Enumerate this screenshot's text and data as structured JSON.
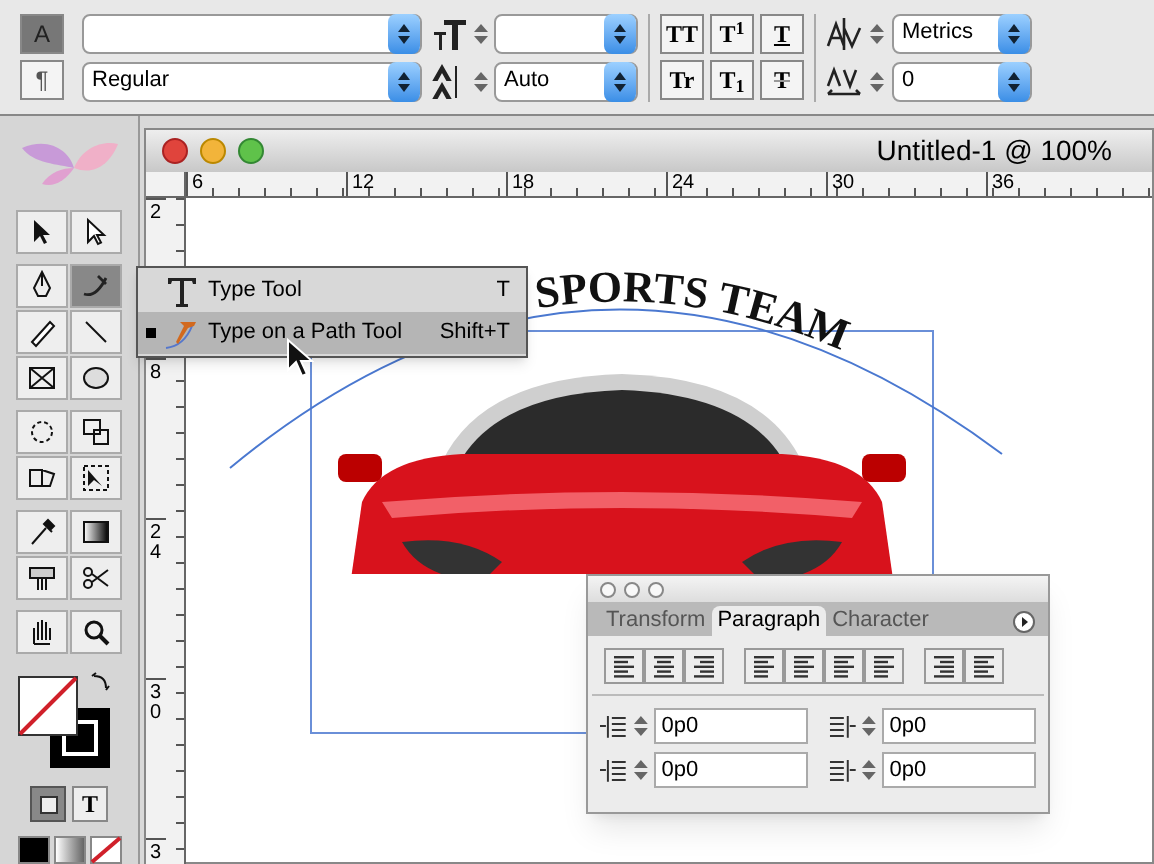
{
  "control_bar": {
    "modes": [
      {
        "label": "A",
        "selected": true
      },
      {
        "label": "¶",
        "selected": false
      }
    ],
    "font_style": "Regular",
    "leading": "Auto",
    "case_buttons": [
      "TT",
      "T$^{1}$",
      "T",
      "Tr",
      "T$_{1}$",
      "T"
    ],
    "kerning": "Metrics",
    "tracking": "0"
  },
  "toolbox": {
    "text_mode": "T"
  },
  "document": {
    "title": "Untitled-1 @ 100%",
    "ruler_h": [
      "6",
      "12",
      "18",
      "24",
      "30",
      "36"
    ],
    "ruler_v": [
      "2",
      "8",
      "24",
      "30",
      "3"
    ],
    "path_text": "SPORTS TEAM"
  },
  "flyout": [
    {
      "label": "Type Tool",
      "shortcut": "T",
      "selected": false
    },
    {
      "label": "Type on a Path Tool",
      "shortcut": "Shift+T",
      "selected": true
    }
  ],
  "paragraph_panel": {
    "tabs": [
      {
        "label": "Transform",
        "selected": false
      },
      {
        "label": "Paragraph",
        "selected": true
      },
      {
        "label": "Character",
        "selected": false
      }
    ],
    "fields": [
      "0p0",
      "0p0",
      "0p0",
      "0p0"
    ]
  }
}
